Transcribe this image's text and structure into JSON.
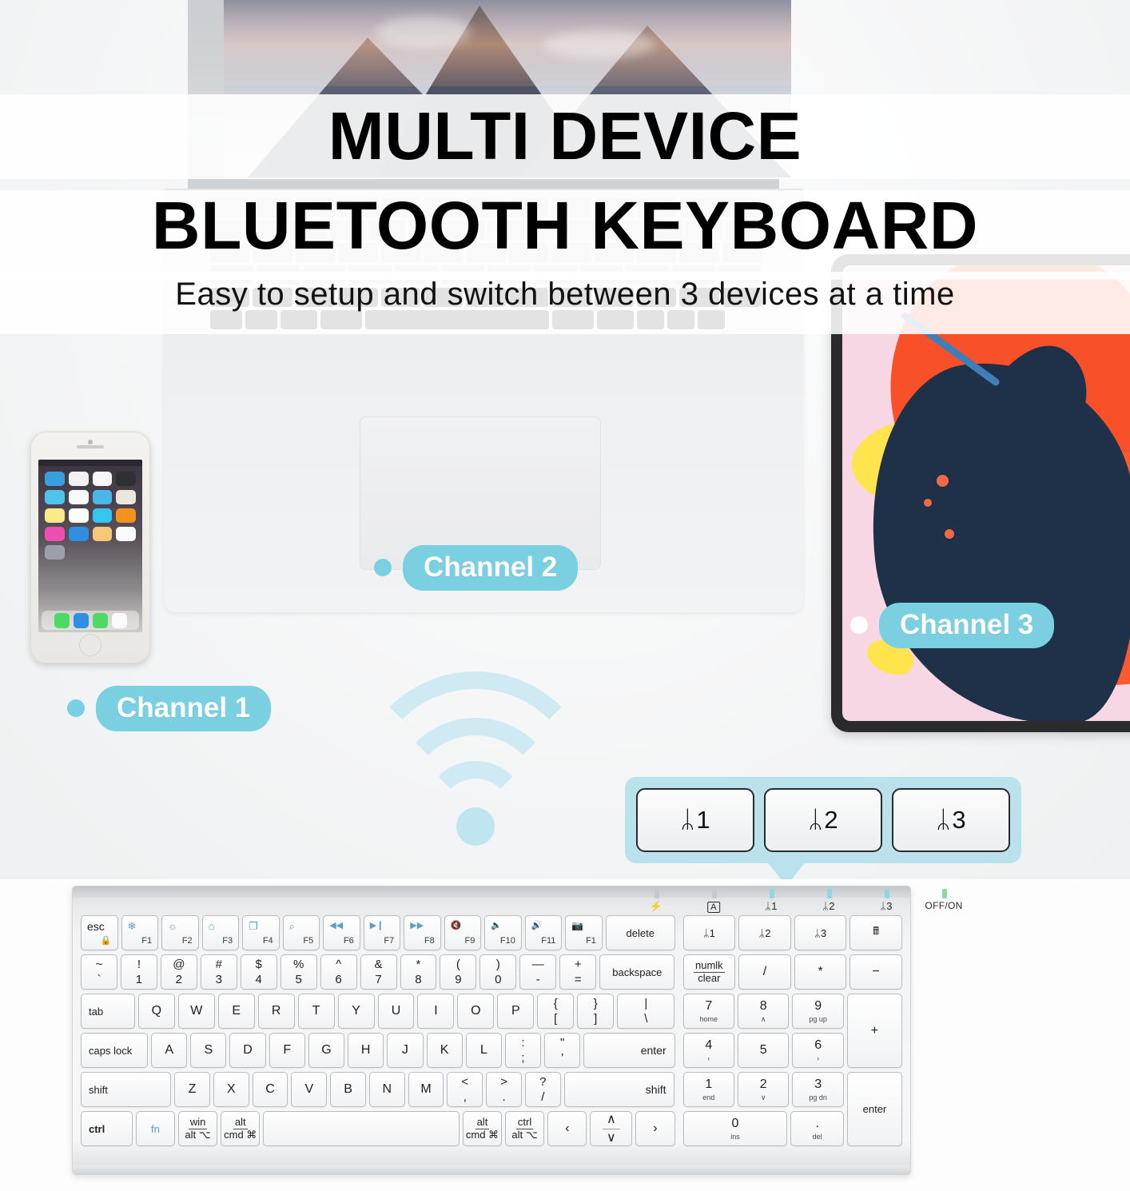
{
  "headline": {
    "line1": "MULTI DEVICE",
    "line2": "BLUETOOTH KEYBOARD",
    "subtitle": "Easy to setup and switch between 3 devices at a time"
  },
  "channels": [
    {
      "label": "Channel 1",
      "device": "smartphone"
    },
    {
      "label": "Channel 2",
      "device": "laptop"
    },
    {
      "label": "Channel 3",
      "device": "tablet"
    }
  ],
  "colors": {
    "pill": "#7ad0e0",
    "callout_bubble": "#b9e2ec",
    "wifi_arc": "#cfeaf2",
    "keyboard_body": "#f3f4f5",
    "fn_blue": "#5b9fc9"
  },
  "callout": {
    "keys": [
      {
        "icon": "bluetooth-icon",
        "glyph": "ᛦ",
        "label": "1"
      },
      {
        "icon": "bluetooth-icon",
        "glyph": "ᛦ",
        "label": "2"
      },
      {
        "icon": "bluetooth-icon",
        "glyph": "ᛦ",
        "label": "3"
      }
    ]
  },
  "keyboard": {
    "indicators": [
      {
        "name": "charging-indicator",
        "glyph": "⚡"
      },
      {
        "name": "caps-lock-indicator",
        "glyph": "A",
        "boxed": true
      },
      {
        "name": "bluetooth-1-indicator",
        "glyph": "ᛦ1"
      },
      {
        "name": "bluetooth-2-indicator",
        "glyph": "ᛦ2"
      },
      {
        "name": "bluetooth-3-indicator",
        "glyph": "ᛦ3"
      },
      {
        "name": "power-switch-label",
        "glyph": "OFF/ON"
      }
    ],
    "function_row": [
      {
        "name": "esc",
        "main": "esc",
        "corner": "ὑ2"
      },
      {
        "name": "f1",
        "icon": "brightness-down-icon",
        "glyph": "❄",
        "label": "F1"
      },
      {
        "name": "f2",
        "icon": "brightness-up-icon",
        "glyph": "☀",
        "label": "F2"
      },
      {
        "name": "f3",
        "icon": "home-icon",
        "glyph": "⌂",
        "label": "F3"
      },
      {
        "name": "f4",
        "icon": "desktop-icon",
        "glyph": "❐",
        "label": "F4"
      },
      {
        "name": "f5",
        "icon": "search-icon",
        "glyph": "⌕",
        "label": "F5"
      },
      {
        "name": "f6",
        "icon": "rewind-icon",
        "glyph": "⏪",
        "label": "F6"
      },
      {
        "name": "f7",
        "icon": "play-pause-icon",
        "glyph": "⏯",
        "label": "F7"
      },
      {
        "name": "f8",
        "icon": "fast-forward-icon",
        "glyph": "⏩",
        "label": "F8"
      },
      {
        "name": "f9",
        "icon": "mute-icon",
        "glyph": "ὐ7",
        "label": "F9"
      },
      {
        "name": "f10",
        "icon": "volume-down-icon",
        "glyph": "ὐ8",
        "label": "F10"
      },
      {
        "name": "f11",
        "icon": "volume-up-icon",
        "glyph": "ὐA",
        "label": "F11"
      },
      {
        "name": "f12",
        "icon": "screenshot-icon",
        "glyph": "὏7",
        "label": "F1"
      },
      {
        "name": "delete",
        "main": "delete"
      },
      {
        "name": "bt1",
        "main": "ᛦ1"
      },
      {
        "name": "bt2",
        "main": "ᛦ2"
      },
      {
        "name": "bt3",
        "main": "ᛦ3"
      },
      {
        "name": "calculator",
        "icon": "calculator-icon",
        "glyph": "὚9"
      }
    ],
    "number_row": [
      {
        "up": "~",
        "dn": "`"
      },
      {
        "up": "!",
        "dn": "1"
      },
      {
        "up": "@",
        "dn": "2"
      },
      {
        "up": "#",
        "dn": "3"
      },
      {
        "up": "$",
        "dn": "4"
      },
      {
        "up": "%",
        "dn": "5"
      },
      {
        "up": "^",
        "dn": "6"
      },
      {
        "up": "&",
        "dn": "7"
      },
      {
        "up": "*",
        "dn": "8"
      },
      {
        "up": "(",
        "dn": "9"
      },
      {
        "up": ")",
        "dn": "0"
      },
      {
        "up": "—",
        "dn": "-"
      },
      {
        "up": "+",
        "dn": "="
      },
      {
        "main": "backspace"
      }
    ],
    "qwerty_row": [
      {
        "main": "tab"
      },
      {
        "main": "Q"
      },
      {
        "main": "W"
      },
      {
        "main": "E"
      },
      {
        "main": "R"
      },
      {
        "main": "T"
      },
      {
        "main": "Y"
      },
      {
        "main": "U"
      },
      {
        "main": "I"
      },
      {
        "main": "O"
      },
      {
        "main": "P"
      },
      {
        "up": "{",
        "dn": "["
      },
      {
        "up": "}",
        "dn": "]"
      },
      {
        "up": "|",
        "dn": "\\"
      }
    ],
    "home_row": [
      {
        "main": "caps lock"
      },
      {
        "main": "A"
      },
      {
        "main": "S"
      },
      {
        "main": "D"
      },
      {
        "main": "F"
      },
      {
        "main": "G"
      },
      {
        "main": "H"
      },
      {
        "main": "J"
      },
      {
        "main": "K"
      },
      {
        "main": "L"
      },
      {
        "up": ":",
        "dn": ";"
      },
      {
        "up": "\"",
        "dn": "'"
      },
      {
        "main": "enter"
      }
    ],
    "shift_row": [
      {
        "main": "shift"
      },
      {
        "main": "Z"
      },
      {
        "main": "X"
      },
      {
        "main": "C"
      },
      {
        "main": "V"
      },
      {
        "main": "B"
      },
      {
        "main": "N"
      },
      {
        "main": "M"
      },
      {
        "up": "<",
        "dn": ","
      },
      {
        "up": ">",
        "dn": "."
      },
      {
        "up": "?",
        "dn": "/"
      },
      {
        "main": "shift"
      }
    ],
    "bottom_row": [
      {
        "main": "ctrl"
      },
      {
        "main": "fn",
        "blue": true
      },
      {
        "top": "win",
        "bot": "alt ⌥"
      },
      {
        "top": "alt",
        "bot": "cmd ⌘"
      },
      {
        "main": ""
      },
      {
        "top": "alt",
        "bot": "cmd ⌘"
      },
      {
        "top": "ctrl",
        "bot": "alt ⌥"
      },
      {
        "main": "‹"
      },
      {
        "main": "∧ / ∨"
      },
      {
        "main": "›"
      }
    ],
    "numpad": [
      [
        {
          "top": "numlk",
          "bot": "clear"
        },
        {
          "main": "/"
        },
        {
          "main": "*"
        },
        {
          "main": "−"
        }
      ],
      [
        {
          "main": "7",
          "sub": "home"
        },
        {
          "main": "8",
          "sub": "∧"
        },
        {
          "main": "9",
          "sub": "pg up"
        },
        {
          "main": "+",
          "tall": true
        }
      ],
      [
        {
          "main": "4",
          "sub": "‹"
        },
        {
          "main": "5"
        },
        {
          "main": "6",
          "sub": "›"
        }
      ],
      [
        {
          "main": "1",
          "sub": "end"
        },
        {
          "main": "2",
          "sub": "∨"
        },
        {
          "main": "3",
          "sub": "pg dn"
        },
        {
          "main": "enter",
          "tall": true
        }
      ],
      [
        {
          "main": "0",
          "sub": "ins"
        },
        {
          "main": ".",
          "sub": "del"
        }
      ]
    ]
  }
}
